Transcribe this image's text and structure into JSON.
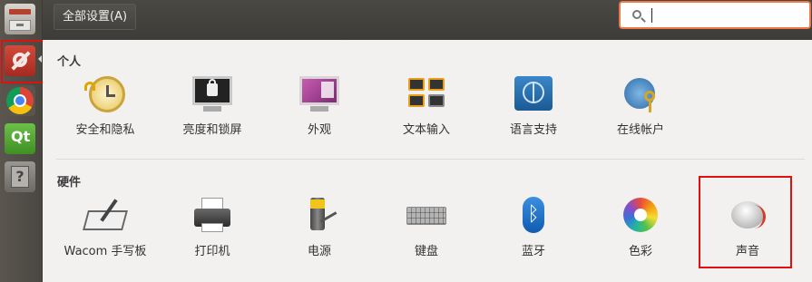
{
  "toolbar": {
    "all_settings_label": "全部设置(A)",
    "search_value": ""
  },
  "sections": {
    "personal": {
      "title": "个人",
      "items": [
        {
          "label": "安全和隐私",
          "icon": "security-privacy-icon"
        },
        {
          "label": "亮度和锁屏",
          "icon": "brightness-lock-icon"
        },
        {
          "label": "外观",
          "icon": "appearance-icon"
        },
        {
          "label": "文本输入",
          "icon": "text-entry-icon"
        },
        {
          "label": "语言支持",
          "icon": "language-support-icon"
        },
        {
          "label": "在线帐户",
          "icon": "online-accounts-icon"
        }
      ]
    },
    "hardware": {
      "title": "硬件",
      "items": [
        {
          "label": "Wacom 手写板",
          "icon": "wacom-tablet-icon"
        },
        {
          "label": "打印机",
          "icon": "printer-icon"
        },
        {
          "label": "电源",
          "icon": "power-icon"
        },
        {
          "label": "键盘",
          "icon": "keyboard-icon"
        },
        {
          "label": "蓝牙",
          "icon": "bluetooth-icon"
        },
        {
          "label": "色彩",
          "icon": "color-icon"
        },
        {
          "label": "声音",
          "icon": "sound-icon"
        }
      ]
    }
  },
  "launcher": {
    "items": [
      {
        "icon": "file-cabinet-icon"
      },
      {
        "icon": "system-settings-icon"
      },
      {
        "icon": "chrome-icon"
      },
      {
        "icon": "qt-creator-icon"
      },
      {
        "icon": "help-icon"
      }
    ]
  }
}
